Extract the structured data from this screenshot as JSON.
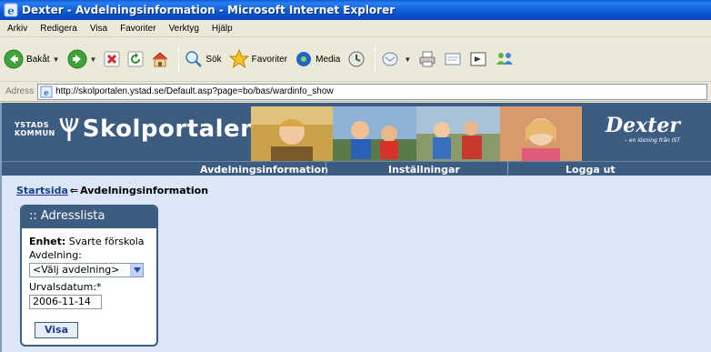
{
  "window": {
    "title": "Dexter - Avdelningsinformation - Microsoft Internet Explorer"
  },
  "menu": [
    "Arkiv",
    "Redigera",
    "Visa",
    "Favoriter",
    "Verktyg",
    "Hjälp"
  ],
  "toolbar": {
    "back": "Bakåt",
    "search": "Sök",
    "favorites": "Favoriter",
    "media": "Media"
  },
  "address": {
    "label": "Adress",
    "url": "http://skolportalen.ystad.se/Default.asp?page=bo/bas/wardinfo_show"
  },
  "header": {
    "kommun_line1": "YSTADS",
    "kommun_line2": "KOMMUN",
    "brand": "Skolportalen",
    "dexter": "Dexter",
    "dexter_sub": "– en lösning från IST"
  },
  "nav": [
    "Avdelningsinformation",
    "Inställningar",
    "Logga ut"
  ],
  "breadcrumb": {
    "home": "Startsida",
    "arrow": "⇐",
    "current": "Avdelningsinformation"
  },
  "panel": {
    "title": ":: Adresslista",
    "unit_label": "Enhet:",
    "unit_value": "Svarte förskola",
    "dept_label": "Avdelning:",
    "dept_selected": "<Välj avdelning>",
    "date_label": "Urvalsdatum:*",
    "date_value": "2006-11-14",
    "button": "Visa"
  },
  "colors": {
    "header": "#3d5c82",
    "page_bg": "#dbe6f6",
    "link": "#1a3e8c"
  }
}
